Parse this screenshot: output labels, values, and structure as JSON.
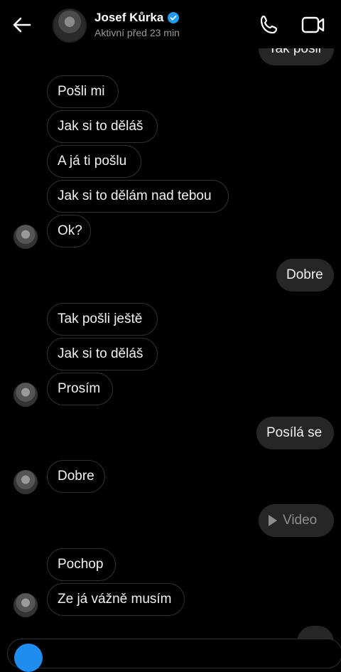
{
  "header": {
    "contact_name": "Josef Kůrka",
    "status": "Aktivní před 23 min"
  },
  "icons": {
    "back": "arrow-left-icon",
    "verified": "verified-badge-icon",
    "call": "phone-icon",
    "video_call": "video-camera-icon",
    "play": "play-icon",
    "camera": "camera-icon"
  },
  "colors": {
    "background": "#000000",
    "outgoing_bubble": "#262626",
    "incoming_border": "#2f2f2f",
    "verified": "#1d9bf0",
    "camera_button": "#1f8df0"
  },
  "messages": [
    {
      "side": "out",
      "text": "Tak pošli"
    },
    {
      "side": "in",
      "text": "Pošli mi"
    },
    {
      "side": "in",
      "text": "Jak si to děláš"
    },
    {
      "side": "in",
      "text": "A já ti pošlu"
    },
    {
      "side": "in",
      "text": "Jak si to dělám nad tebou"
    },
    {
      "side": "in",
      "text": "Ok?"
    },
    {
      "side": "out",
      "text": "Dobre"
    },
    {
      "side": "in",
      "text": "Tak pošli ještě"
    },
    {
      "side": "in",
      "text": "Jak si to děláš"
    },
    {
      "side": "in",
      "text": "Prosím"
    },
    {
      "side": "out",
      "text": "Posílá se"
    },
    {
      "side": "in",
      "text": "Dobre"
    },
    {
      "side": "out",
      "text": "Video",
      "kind": "video"
    },
    {
      "side": "in",
      "text": "Pochop"
    },
    {
      "side": "in",
      "text": "Ze já vážně musím"
    }
  ]
}
